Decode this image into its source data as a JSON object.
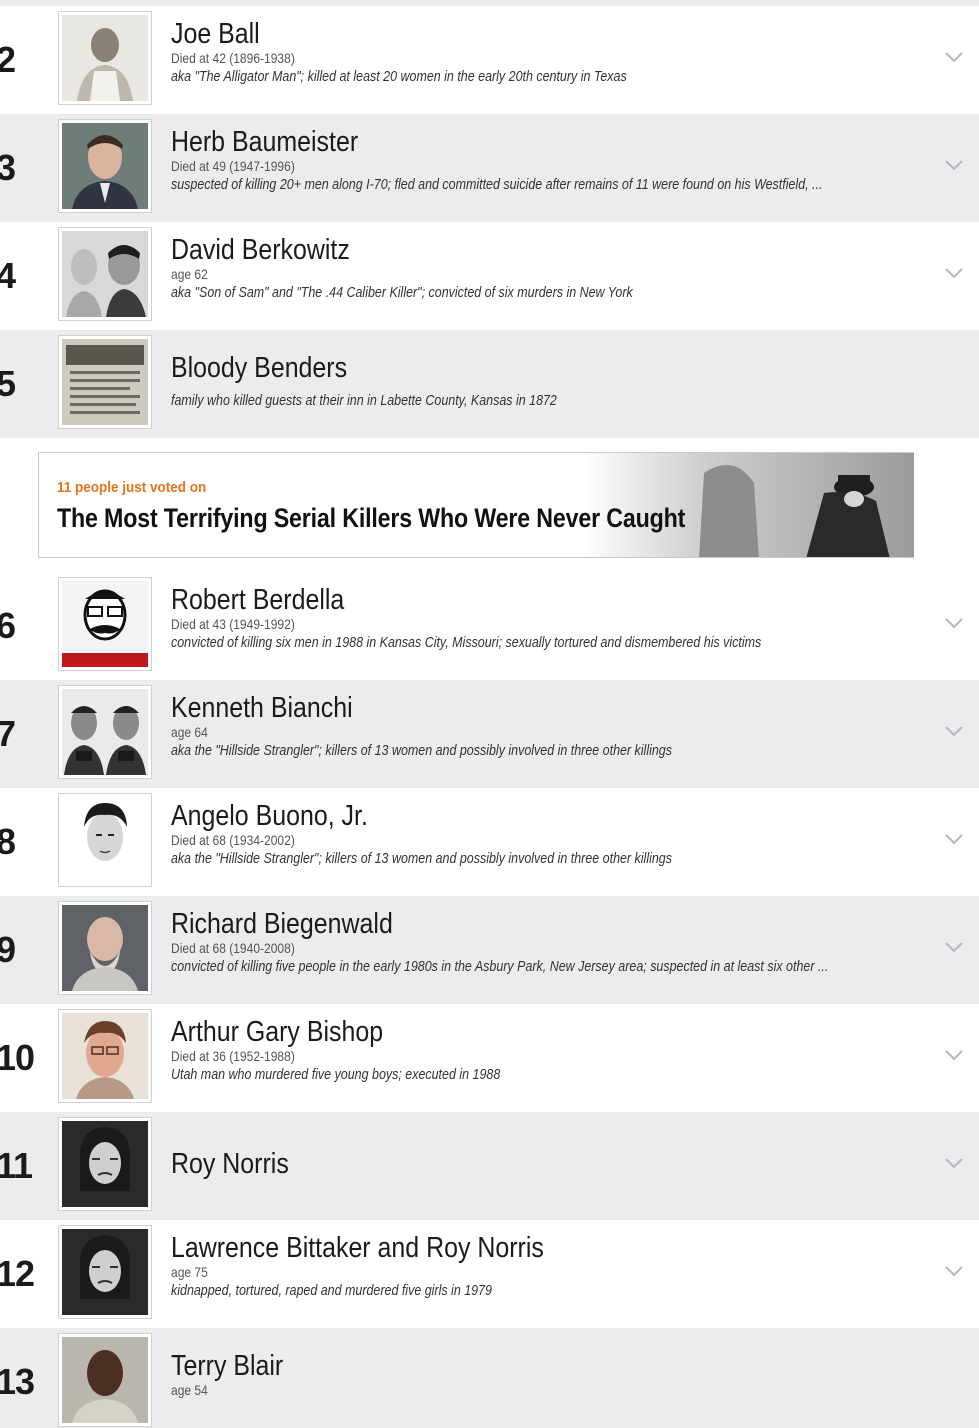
{
  "list": {
    "items": [
      {
        "rank": "2",
        "name": "Joe Ball",
        "meta": "Died at 42 (1896-1938)",
        "desc": "aka \"The Alligator Man\"; killed at least 20 women in the early 20th century in Texas"
      },
      {
        "rank": "3",
        "name": "Herb Baumeister",
        "meta": "Died at 49 (1947-1996)",
        "desc": "suspected of killing 20+ men along I-70; fled and committed suicide after remains of 11 were found on his Westfield, ..."
      },
      {
        "rank": "4",
        "name": "David Berkowitz",
        "meta": "age 62",
        "desc": "aka \"Son of Sam\" and \"The .44 Caliber Killer\"; convicted of six murders in New York"
      },
      {
        "rank": "5",
        "name": "Bloody Benders",
        "meta": "",
        "desc": "family who killed guests at their inn in Labette County, Kansas in 1872"
      },
      {
        "rank": "6",
        "name": "Robert Berdella",
        "meta": "Died at 43 (1949-1992)",
        "desc": "convicted of killing six men in 1988 in Kansas City, Missouri; sexually tortured and dismembered his victims"
      },
      {
        "rank": "7",
        "name": "Kenneth Bianchi",
        "meta": "age 64",
        "desc": "aka the \"Hillside Strangler\"; killers of 13 women and possibly involved in three other killings"
      },
      {
        "rank": "8",
        "name": "Angelo Buono, Jr.",
        "meta": "Died at 68 (1934-2002)",
        "desc": "aka the \"Hillside Strangler\"; killers of 13 women and possibly involved in three other killings"
      },
      {
        "rank": "9",
        "name": "Richard Biegenwald",
        "meta": "Died at 68 (1940-2008)",
        "desc": "convicted of killing five people in the early 1980s in the Asbury Park, New Jersey area; suspected in at least six other ..."
      },
      {
        "rank": "10",
        "name": "Arthur Gary Bishop",
        "meta": "Died at 36 (1952-1988)",
        "desc": "Utah man who murdered five young boys; executed in 1988"
      },
      {
        "rank": "11",
        "name": "Roy Norris",
        "meta": "",
        "desc": ""
      },
      {
        "rank": "12",
        "name": "Lawrence Bittaker and Roy Norris",
        "meta": "age 75",
        "desc": "kidnapped, tortured, raped and murdered five girls in 1979"
      },
      {
        "rank": "13",
        "name": "Terry Blair",
        "meta": "age 54",
        "desc": ""
      }
    ]
  },
  "banner": {
    "voted": "11 people just voted on",
    "title": "The Most Terrifying Serial Killers Who Were Never Caught"
  },
  "colors": {
    "row_alt": "#ececef",
    "accent": "#e8731a",
    "chevron": "#b5b5bb"
  },
  "icons": {
    "expand": "chevron-down-icon"
  }
}
